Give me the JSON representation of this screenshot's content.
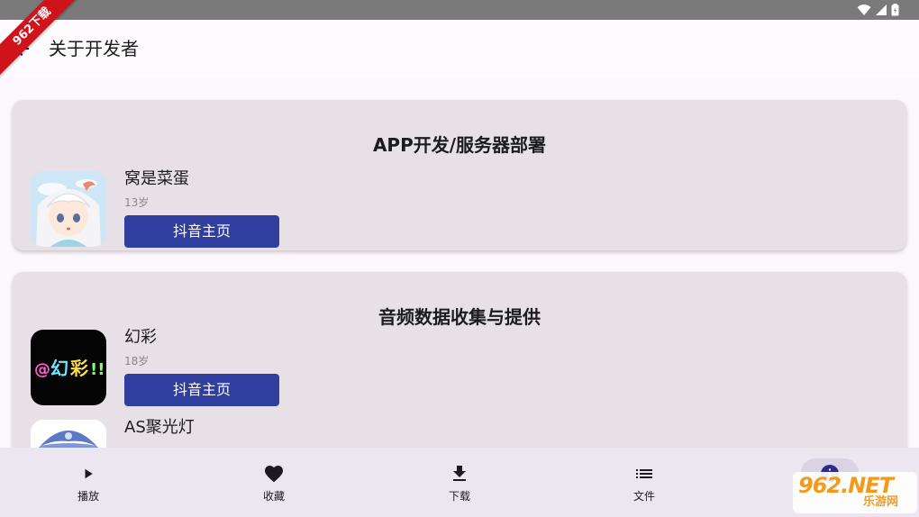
{
  "status_bar": {
    "icons": [
      "wifi-icon",
      "signal-icon",
      "battery-icon"
    ]
  },
  "corner_ribbon": {
    "text": "962下载"
  },
  "app_bar": {
    "title": "关于开发者",
    "back_icon": "arrow-back-icon"
  },
  "cards": [
    {
      "title": "APP开发/服务器部署",
      "developers": [
        {
          "name": "窝是菜蛋",
          "age": "13岁",
          "button": "抖音主页",
          "avatar": "anime-girl-avatar"
        }
      ]
    },
    {
      "title": "音频数据收集与提供",
      "developers": [
        {
          "name": "幻彩",
          "age": "18岁",
          "button": "抖音主页",
          "avatar": "neon-text-avatar"
        },
        {
          "name": "AS聚光灯",
          "age": "",
          "button": "",
          "avatar": "wizard-avatar"
        }
      ]
    }
  ],
  "bottom_nav": {
    "items": [
      {
        "label": "播放",
        "icon": "play-icon"
      },
      {
        "label": "收藏",
        "icon": "heart-icon"
      },
      {
        "label": "下载",
        "icon": "download-icon"
      },
      {
        "label": "文件",
        "icon": "list-icon"
      },
      {
        "label": "",
        "icon": "info-icon",
        "selected": true
      }
    ]
  },
  "watermark": {
    "main": "962.NET",
    "sub": "乐游网"
  },
  "colors": {
    "button": "#303f9f",
    "card": "#e7e0e6",
    "nav": "#ece6f0",
    "status_bar": "#7a7a7a",
    "ribbon": "#d0121b"
  }
}
